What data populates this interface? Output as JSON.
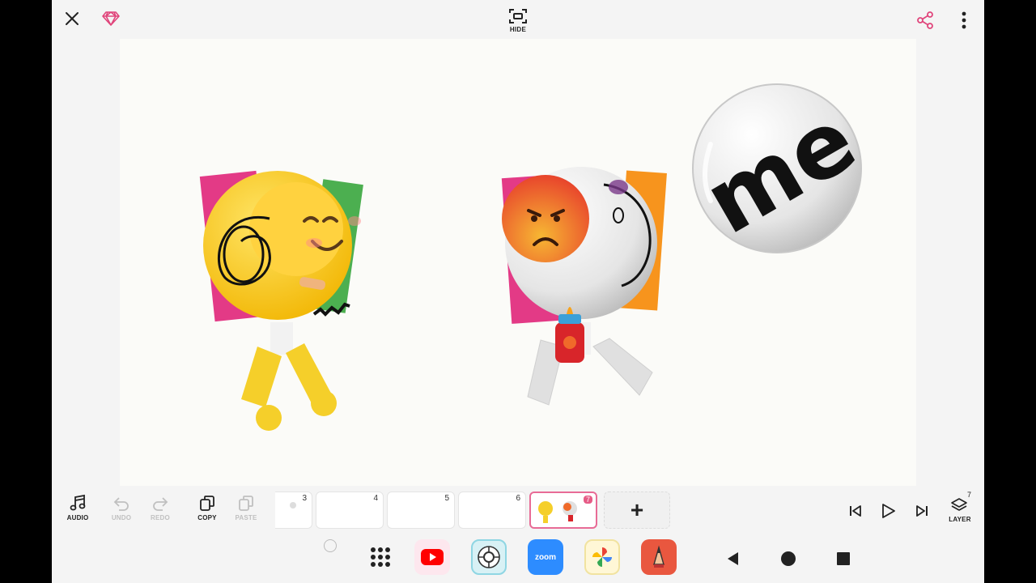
{
  "topbar": {
    "hide_label": "HIDE",
    "accent": "#e0457b"
  },
  "canvas": {
    "sticker_text": "me",
    "background": "#fbfbf8"
  },
  "toolbar": {
    "audio": "AUDIO",
    "undo": "UNDO",
    "redo": "REDO",
    "copy": "COPY",
    "paste": "PASTE",
    "layer": "LAYER",
    "layer_count": "7",
    "add": "+"
  },
  "frames": [
    {
      "num": "3"
    },
    {
      "num": "4"
    },
    {
      "num": "5"
    },
    {
      "num": "6"
    },
    {
      "num": "7",
      "active": true
    }
  ],
  "navbar": {
    "zoom_label": "zoom",
    "apps": [
      "apps-grid-icon",
      "youtube-icon",
      "camera-app-icon",
      "zoom-icon",
      "photos-icon",
      "sketchbook-icon"
    ]
  }
}
